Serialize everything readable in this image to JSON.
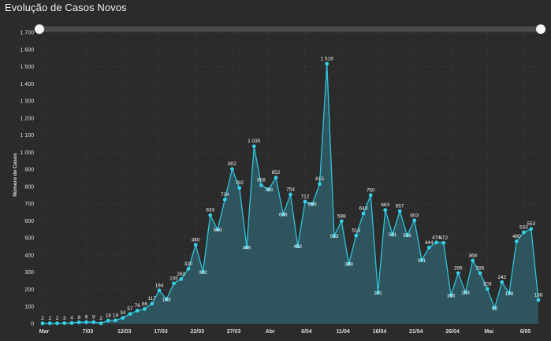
{
  "title": "Evolução de Casos Novos",
  "colors": {
    "line": "#2fc4dc",
    "point": "#35d0ea",
    "area": "#2f5c66",
    "grid": "#3e3e3e",
    "slider_track": "#4a4a4a",
    "slider_handle": "#f5f5f5"
  },
  "chart_data": {
    "type": "area",
    "ylabel": "Número de Casos",
    "xlabel": "",
    "ylim": [
      0,
      1700
    ],
    "yticks": [
      0,
      100,
      200,
      300,
      400,
      500,
      600,
      700,
      800,
      900,
      1000,
      1100,
      1200,
      1300,
      1400,
      1500,
      1600,
      1700
    ],
    "ytick_labels": [
      "0",
      "100",
      "200",
      "300",
      "400",
      "500",
      "600",
      "700",
      "800",
      "900",
      "1 000",
      "1 100",
      "1 200",
      "1 300",
      "1 400",
      "1 500",
      "1 600",
      "1 700"
    ],
    "x_ticks": [
      {
        "index": 0,
        "label": "Mar"
      },
      {
        "index": 6,
        "label": "7/03"
      },
      {
        "index": 11,
        "label": "12/03"
      },
      {
        "index": 16,
        "label": "17/03"
      },
      {
        "index": 21,
        "label": "22/03"
      },
      {
        "index": 26,
        "label": "27/03"
      },
      {
        "index": 31,
        "label": "Abr"
      },
      {
        "index": 36,
        "label": "6/04"
      },
      {
        "index": 41,
        "label": "11/04"
      },
      {
        "index": 46,
        "label": "16/04"
      },
      {
        "index": 51,
        "label": "21/04"
      },
      {
        "index": 56,
        "label": "26/04"
      },
      {
        "index": 61,
        "label": "Mai"
      },
      {
        "index": 66,
        "label": "6/05"
      }
    ],
    "grid": true,
    "legend": "none",
    "series": [
      {
        "values": [
          2,
          2,
          2,
          3,
          4,
          8,
          9,
          9,
          2,
          18,
          19,
          34,
          57,
          76,
          86,
          117,
          194,
          143,
          235,
          260,
          320,
          460,
          302,
          633,
          549,
          724,
          902,
          792,
          446,
          1035,
          808,
          783,
          852,
          638,
          754,
          452,
          712,
          699,
          815,
          1516,
          513,
          598,
          349,
          514,
          643,
          750,
          181,
          663,
          521,
          657,
          516,
          603,
          371,
          444,
          474,
          472,
          165,
          295,
          183,
          368,
          295,
          203,
          92,
          242,
          178,
          480,
          533,
          553,
          138
        ],
        "labels": [
          "2",
          "2",
          "2",
          "3",
          "4",
          "8",
          "9",
          "9",
          "2",
          "18",
          "19",
          "34",
          "57",
          "76",
          "86",
          "117",
          "194",
          "143",
          "235",
          "260",
          "320",
          "460",
          "302",
          "633",
          "549",
          "724",
          "902",
          "792",
          "446",
          "1 035",
          "808",
          "783",
          "852",
          "638",
          "754",
          "452",
          "712",
          "699",
          "815",
          "1 516",
          "513",
          "598",
          "349",
          "514",
          "643",
          "750",
          "181",
          "663",
          "521",
          "657",
          "516",
          "603",
          "371",
          "444",
          "474",
          "472",
          "165",
          "295",
          "183",
          "368",
          "295",
          "203",
          "92",
          "242",
          "178",
          "480",
          "533",
          "553",
          "138"
        ]
      }
    ]
  }
}
